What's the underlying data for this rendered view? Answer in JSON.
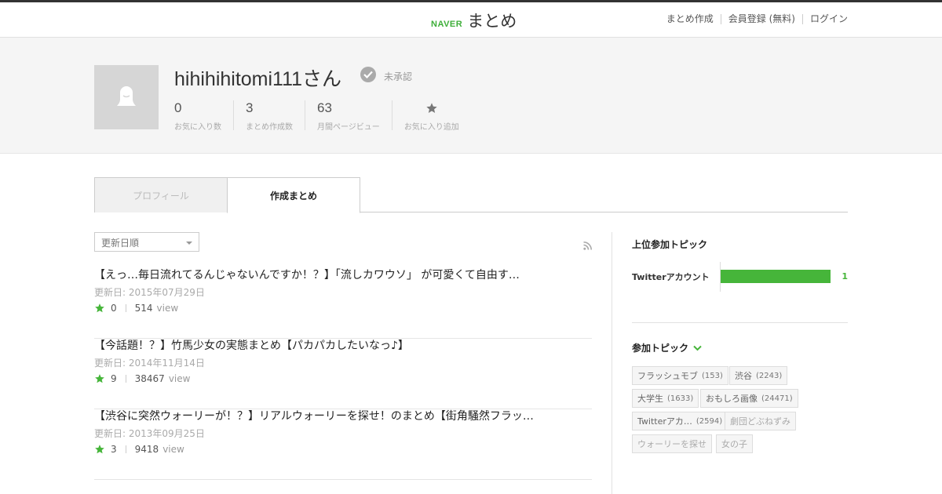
{
  "header": {
    "logo_brand": "NAVER",
    "logo_service": "まとめ",
    "nav": [
      "まとめ作成",
      "会員登録 (無料)",
      "ログイン"
    ]
  },
  "profile": {
    "username": "hihihihitomi111さん",
    "verified_status": "未承認",
    "stats": [
      {
        "value": "0",
        "label": "お気に入り数"
      },
      {
        "value": "3",
        "label": "まとめ作成数"
      },
      {
        "value": "63",
        "label": "月間ページビュー"
      }
    ],
    "favorite_add_label": "お気に入り追加"
  },
  "tabs": {
    "profile": "プロフィール",
    "created": "作成まとめ"
  },
  "sort": {
    "selected": "更新日順"
  },
  "articles": [
    {
      "title": "【えっ…毎日流れてるんじゃないんですか！？】「流しカワウソ」 が可愛くて自由す…",
      "date": "更新日: 2015年07月29日",
      "favorites": "0",
      "views": "514",
      "view_unit": "view"
    },
    {
      "title": "【今話題！？】竹馬少女の実態まとめ【パカパカしたいなっ♪】",
      "date": "更新日: 2014年11月14日",
      "favorites": "9",
      "views": "38467",
      "view_unit": "view"
    },
    {
      "title": "【渋谷に突然ウォーリーが！？】リアルウォーリーを探せ！のまとめ【街角騒然フラッ…",
      "date": "更新日: 2013年09月25日",
      "favorites": "3",
      "views": "9418",
      "view_unit": "view"
    }
  ],
  "sidebar": {
    "top_topics_title": "上位参加トピック",
    "top_topics": [
      {
        "name": "Twitterアカウント",
        "count": "1",
        "share": 1.0
      }
    ],
    "joined_topics_title": "参加トピック",
    "tags": [
      {
        "label": "フラッシュモブ",
        "count": "(153)"
      },
      {
        "label": "渋谷",
        "count": "(2243)"
      },
      {
        "label": "大学生",
        "count": "(1633)"
      },
      {
        "label": "おもしろ画像",
        "count": "(24471)"
      },
      {
        "label": "Twitterアカ…",
        "count": "(2594)"
      },
      {
        "label": "劇団どぶねずみ",
        "count": ""
      },
      {
        "label": "ウォーリーを探せ",
        "count": ""
      },
      {
        "label": "女の子",
        "count": ""
      }
    ]
  },
  "colors": {
    "accent_green": "#46b53a",
    "header_line": "#333333",
    "profile_band_bg": "#f5f5f5"
  }
}
